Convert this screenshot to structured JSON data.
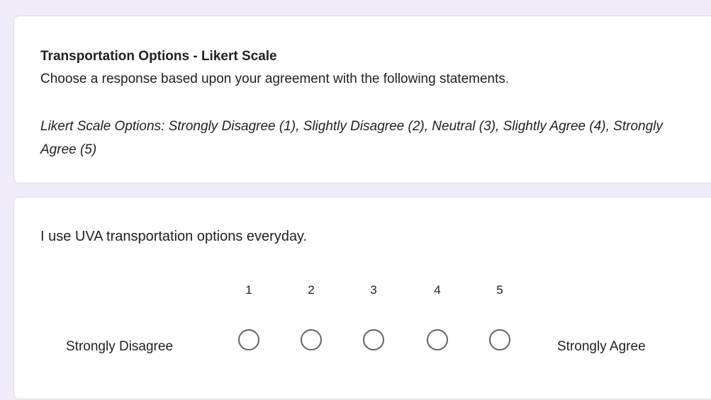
{
  "header": {
    "title": "Transportation Options - Likert Scale",
    "description": "Choose a response based upon your agreement with the following statements.",
    "note": "Likert Scale Options: Strongly Disagree (1), Slightly Disagree (2), Neutral (3), Slightly Agree (4), Strongly Agree (5)"
  },
  "question": {
    "text": "I use UVA transportation options everyday.",
    "low_label": "Strongly Disagree",
    "high_label": "Strongly Agree",
    "scale": [
      "1",
      "2",
      "3",
      "4",
      "5"
    ],
    "selected": null
  },
  "colors": {
    "page_background": "#f0ebf8",
    "card_background": "#ffffff",
    "radio_border": "#5f6368",
    "text": "#202124"
  }
}
